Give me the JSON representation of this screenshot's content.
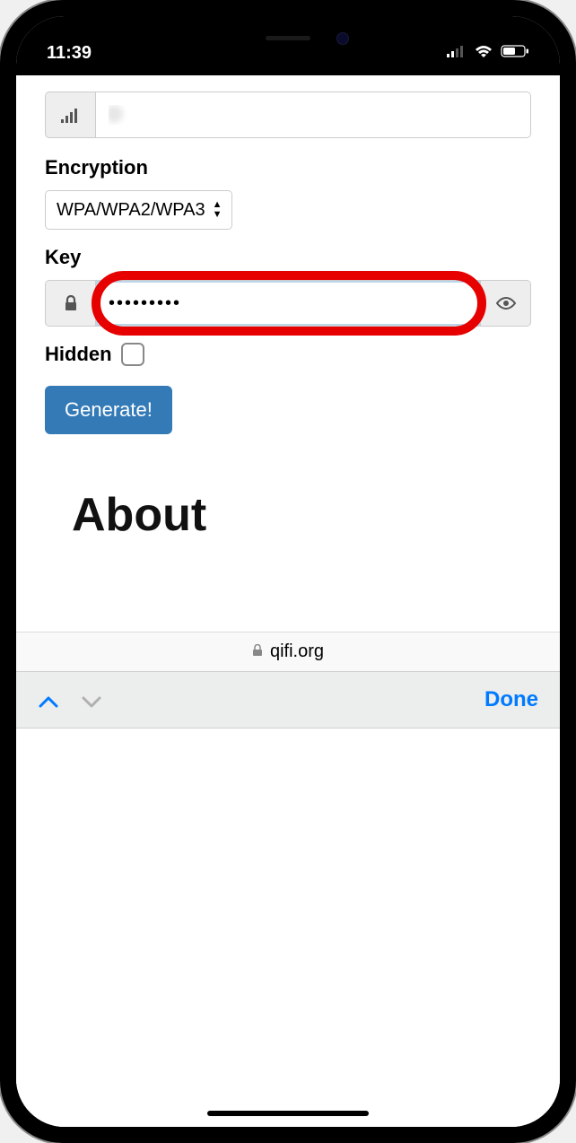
{
  "statusbar": {
    "time": "11:39"
  },
  "form": {
    "ssid_value": "D",
    "encryption_label": "Encryption",
    "encryption_value": "WPA/WPA2/WPA3",
    "key_label": "Key",
    "key_value": "•••••••••",
    "hidden_label": "Hidden",
    "hidden_checked": false,
    "generate_label": "Generate!"
  },
  "about": {
    "heading": "About"
  },
  "browser": {
    "url": "qifi.org"
  },
  "accessory": {
    "done_label": "Done"
  }
}
